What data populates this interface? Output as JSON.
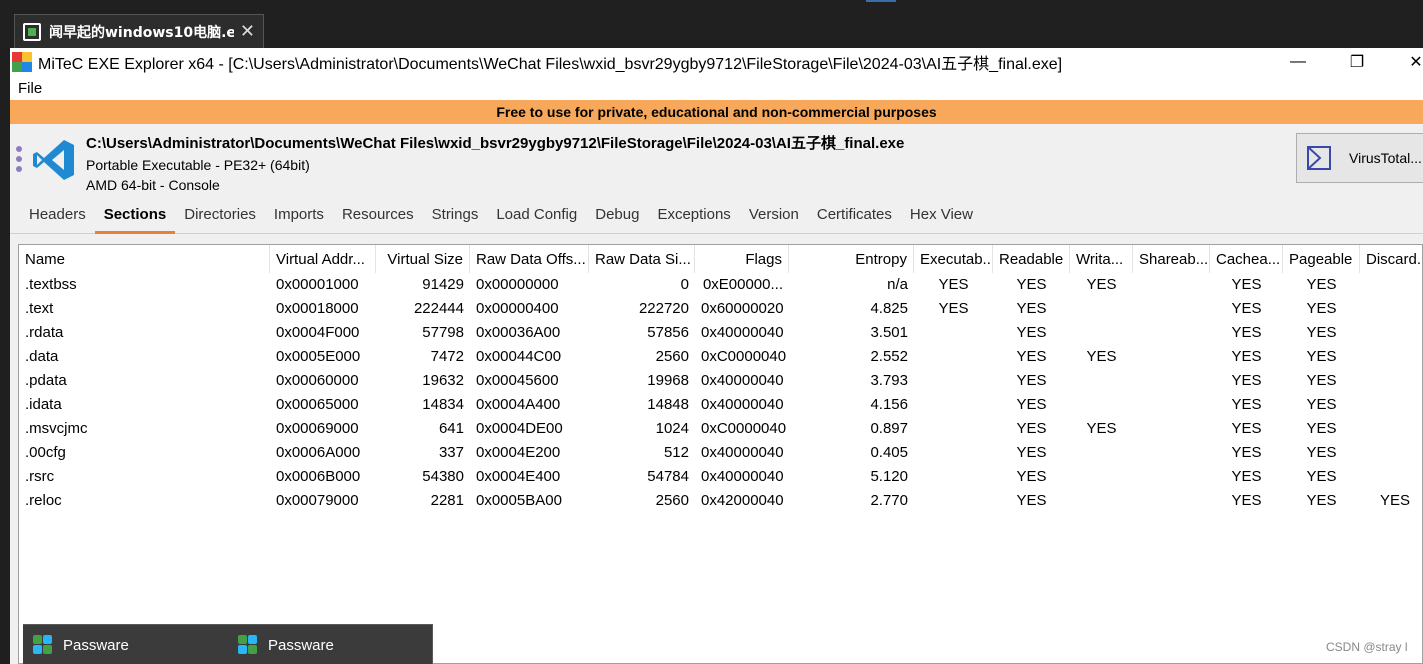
{
  "host": {
    "tab_title": "闻早起的windows10电脑.e...",
    "tab_close": "✕"
  },
  "window": {
    "title": "MiTeC EXE Explorer x64 - [C:\\Users\\Administrator\\Documents\\WeChat Files\\wxid_bsvr29ygby9712\\FileStorage\\File\\2024-03\\AI五子棋_final.exe]",
    "min_glyph": "—",
    "max_glyph": "❐",
    "close_glyph": "✕"
  },
  "menu": {
    "file": "File"
  },
  "banner": "Free to use for private, educational and non-commercial  purposes",
  "file_info": {
    "path": "C:\\Users\\Administrator\\Documents\\WeChat Files\\wxid_bsvr29ygby9712\\FileStorage\\File\\2024-03\\AI五子棋_final.exe",
    "type": "Portable Executable - PE32+ (64bit)",
    "arch": "AMD 64-bit - Console",
    "virustotal_label": "VirusTotal..."
  },
  "tabs": [
    "Headers",
    "Sections",
    "Directories",
    "Imports",
    "Resources",
    "Strings",
    "Load Config",
    "Debug",
    "Exceptions",
    "Version",
    "Certificates",
    "Hex View"
  ],
  "active_tab": "Sections",
  "sections_table": {
    "columns": [
      "Name",
      "Virtual Addr...",
      "Virtual Size",
      "Raw Data Offs...",
      "Raw Data Si...",
      "Flags",
      "Entropy",
      "Executab...",
      "Readable",
      "Writa...",
      "Shareab...",
      "Cachea...",
      "Pageable",
      "Discard..."
    ],
    "rows": [
      [
        ".textbss",
        "0x00001000",
        "91429",
        "0x00000000",
        "0",
        "0xE00000...",
        "n/a",
        "YES",
        "YES",
        "YES",
        "",
        "YES",
        "YES",
        ""
      ],
      [
        ".text",
        "0x00018000",
        "222444",
        "0x00000400",
        "222720",
        "0x60000020",
        "4.825",
        "YES",
        "YES",
        "",
        "",
        "YES",
        "YES",
        ""
      ],
      [
        ".rdata",
        "0x0004F000",
        "57798",
        "0x00036A00",
        "57856",
        "0x40000040",
        "3.501",
        "",
        "YES",
        "",
        "",
        "YES",
        "YES",
        ""
      ],
      [
        ".data",
        "0x0005E000",
        "7472",
        "0x00044C00",
        "2560",
        "0xC0000040",
        "2.552",
        "",
        "YES",
        "YES",
        "",
        "YES",
        "YES",
        ""
      ],
      [
        ".pdata",
        "0x00060000",
        "19632",
        "0x00045600",
        "19968",
        "0x40000040",
        "3.793",
        "",
        "YES",
        "",
        "",
        "YES",
        "YES",
        ""
      ],
      [
        ".idata",
        "0x00065000",
        "14834",
        "0x0004A400",
        "14848",
        "0x40000040",
        "4.156",
        "",
        "YES",
        "",
        "",
        "YES",
        "YES",
        ""
      ],
      [
        ".msvcjmc",
        "0x00069000",
        "641",
        "0x0004DE00",
        "1024",
        "0xC0000040",
        "0.897",
        "",
        "YES",
        "YES",
        "",
        "YES",
        "YES",
        ""
      ],
      [
        ".00cfg",
        "0x0006A000",
        "337",
        "0x0004E200",
        "512",
        "0x40000040",
        "0.405",
        "",
        "YES",
        "",
        "",
        "YES",
        "YES",
        ""
      ],
      [
        ".rsrc",
        "0x0006B000",
        "54380",
        "0x0004E400",
        "54784",
        "0x40000040",
        "5.120",
        "",
        "YES",
        "",
        "",
        "YES",
        "YES",
        ""
      ],
      [
        ".reloc",
        "0x00079000",
        "2281",
        "0x0005BA00",
        "2560",
        "0x42000040",
        "2.770",
        "",
        "YES",
        "",
        "",
        "YES",
        "YES",
        "YES"
      ]
    ]
  },
  "taskbar_preview": [
    "Passware",
    "Passware"
  ],
  "watermark": "CSDN @stray l",
  "colors": {
    "banner": "#f8a85a",
    "active_tab_underline": "#e8803a",
    "vscode_blue": "#1f8ad2"
  }
}
